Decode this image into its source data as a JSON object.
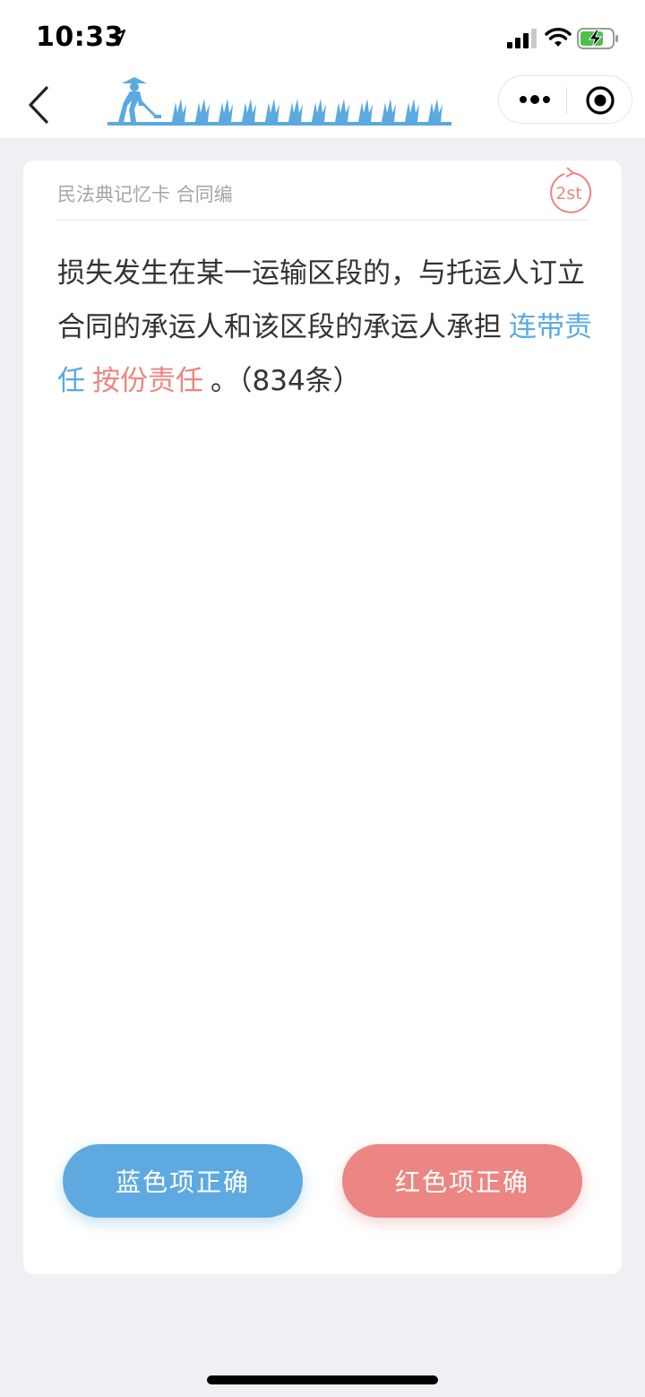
{
  "status_bar": {
    "time": "10:33",
    "icons": [
      "location-arrow-icon",
      "signal-icon",
      "wifi-icon",
      "battery-charging-icon"
    ]
  },
  "nav": {
    "back_icon": "chevron-left-icon",
    "logo_icon": "farmer-weeding-grass-icon",
    "logo_color": "#5aa9e0",
    "more_icon": "more-dots-icon",
    "close_icon": "target-circle-icon"
  },
  "card": {
    "title": "民法典记忆卡 合同编",
    "badge_text": "2st",
    "badge_color": "#ec8582",
    "question_text": "损失发生在某一运输区段的，与托运人订立合同的承运人和该区段的承运人承担",
    "option_blue": "连带责任",
    "option_red": "按份责任",
    "question_suffix": "。（834条）",
    "blue_color": "#5aa9e0",
    "red_color": "#ec8582"
  },
  "buttons": {
    "blue_label": "蓝色项正确",
    "red_label": "红色项正确"
  }
}
